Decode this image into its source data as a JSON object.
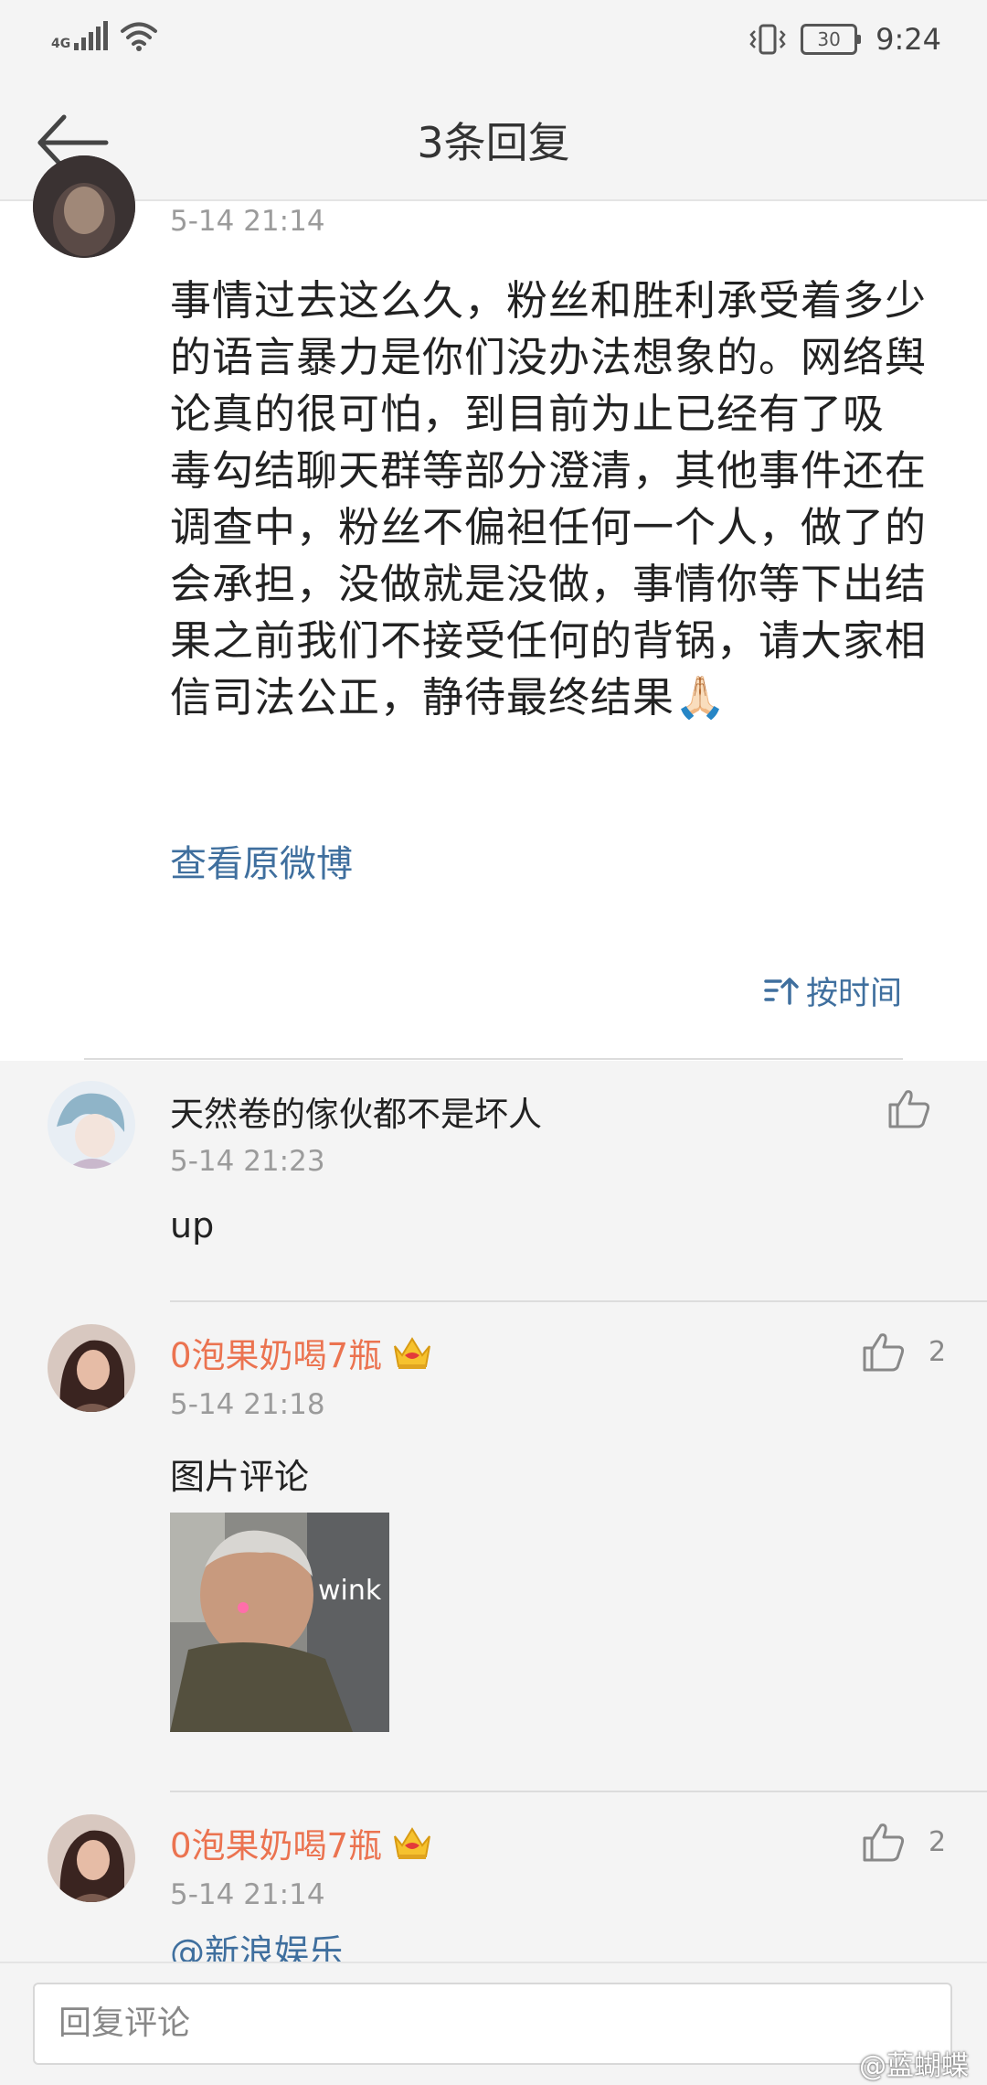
{
  "status_bar": {
    "network": "4G",
    "battery": "30",
    "time": "9:24"
  },
  "header": {
    "title": "3条回复"
  },
  "main_comment": {
    "time": "5-14 21:14",
    "text": "事情过去这么久，粉丝和胜利承受着多少的语言暴力是你们没办法想象的。网络舆论真的很可怕，到目前为止已经有了吸 毒勾结聊天群等部分澄清，其他事件还在调查中，粉丝不偏袒任何一个人，做了的会承担，没做就是没做，事情你等下出结果之前我们不接受任何的背锅，请大家相信司法公正，静待最终结果🙏🏻",
    "view_original": "查看原微博"
  },
  "sort": {
    "label": "按时间"
  },
  "replies": [
    {
      "username": "天然卷的傢伙都不是坏人",
      "time": "5-14 21:23",
      "text": "up",
      "likes": ""
    },
    {
      "username": "0泡果奶喝7瓶",
      "time": "5-14 21:18",
      "text": "图片评论",
      "image_caption": "wink",
      "likes": "2"
    },
    {
      "username": "0泡果奶喝7瓶",
      "time": "5-14 21:14",
      "text": "@新浪娱乐",
      "likes": "2"
    }
  ],
  "reply_input": {
    "placeholder": "回复评论"
  },
  "watermark": "@蓝蝴蝶",
  "colors": {
    "link": "#3f6f9e",
    "username_vip": "#eb7350",
    "background": "#f4f4f4"
  }
}
